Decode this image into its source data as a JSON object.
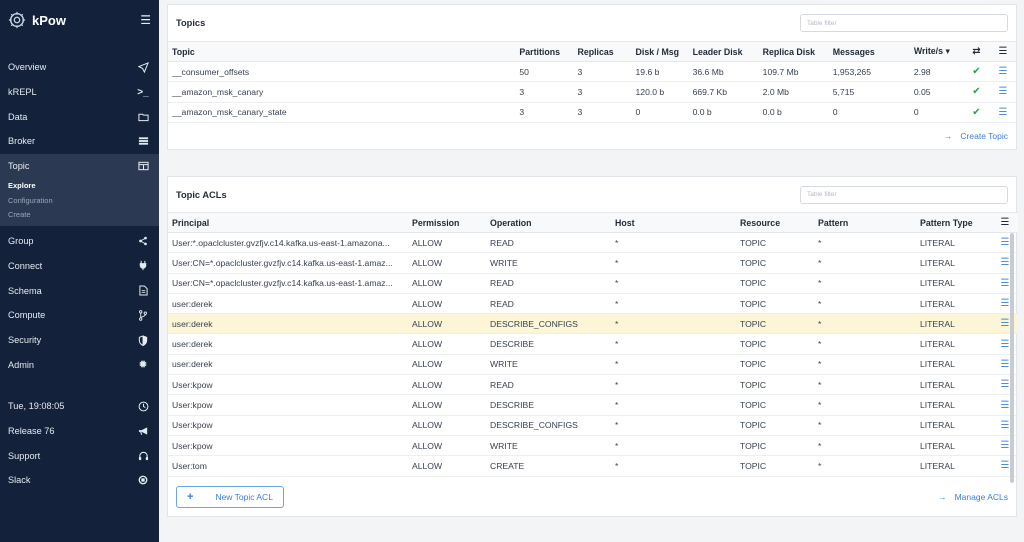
{
  "brand": {
    "name": "kPow"
  },
  "sidebar": {
    "items": [
      {
        "label": "Overview",
        "icon": "send-icon"
      },
      {
        "label": "kREPL",
        "icon": "terminal-icon"
      },
      {
        "label": "Data",
        "icon": "folder-icon"
      },
      {
        "label": "Broker",
        "icon": "server-icon"
      },
      {
        "label": "Topic",
        "icon": "table-icon"
      },
      {
        "label": "Group",
        "icon": "share-icon"
      },
      {
        "label": "Connect",
        "icon": "plug-icon"
      },
      {
        "label": "Schema",
        "icon": "file-icon"
      },
      {
        "label": "Compute",
        "icon": "branch-icon"
      },
      {
        "label": "Security",
        "icon": "shield-icon"
      },
      {
        "label": "Admin",
        "icon": "gear-icon"
      }
    ],
    "topic_sub": [
      "Explore",
      "Configuration",
      "Create"
    ],
    "footer": [
      {
        "label": "Tue, 19:08:05",
        "icon": "clock-icon"
      },
      {
        "label": "Release 76",
        "icon": "megaphone-icon"
      },
      {
        "label": "Support",
        "icon": "headset-icon"
      },
      {
        "label": "Slack",
        "icon": "slack-icon"
      }
    ]
  },
  "topics": {
    "title": "Topics",
    "filter_placeholder": "Table filter",
    "columns": [
      "Topic",
      "Partitions",
      "Replicas",
      "Disk / Msg",
      "Leader Disk",
      "Replica Disk",
      "Messages",
      "Write/s ▾"
    ],
    "rows": [
      [
        "__consumer_offsets",
        "50",
        "3",
        "19.6 b",
        "36.6 Mb",
        "109.7 Mb",
        "1,953,265",
        "2.98"
      ],
      [
        "__amazon_msk_canary",
        "3",
        "3",
        "120.0 b",
        "669.7 Kb",
        "2.0 Mb",
        "5,715",
        "0.05"
      ],
      [
        "__amazon_msk_canary_state",
        "3",
        "3",
        "0",
        "0.0 b",
        "0.0 b",
        "0",
        "0"
      ]
    ],
    "create_link": "Create Topic"
  },
  "acls": {
    "title": "Topic ACLs",
    "filter_placeholder": "Table filter",
    "columns": [
      "Principal",
      "Permission",
      "Operation",
      "Host",
      "Resource",
      "Pattern",
      "Pattern Type"
    ],
    "rows": [
      [
        "User:*.opaclcluster.gvzfjv.c14.kafka.us-east-1.amazona...",
        "ALLOW",
        "READ",
        "*",
        "TOPIC",
        "*",
        "LITERAL"
      ],
      [
        "User:CN=*.opaclcluster.gvzfjv.c14.kafka.us-east-1.amaz...",
        "ALLOW",
        "WRITE",
        "*",
        "TOPIC",
        "*",
        "LITERAL"
      ],
      [
        "User:CN=*.opaclcluster.gvzfjv.c14.kafka.us-east-1.amaz...",
        "ALLOW",
        "READ",
        "*",
        "TOPIC",
        "*",
        "LITERAL"
      ],
      [
        "user:derek",
        "ALLOW",
        "READ",
        "*",
        "TOPIC",
        "*",
        "LITERAL"
      ],
      [
        "user:derek",
        "ALLOW",
        "DESCRIBE_CONFIGS",
        "*",
        "TOPIC",
        "*",
        "LITERAL"
      ],
      [
        "user:derek",
        "ALLOW",
        "DESCRIBE",
        "*",
        "TOPIC",
        "*",
        "LITERAL"
      ],
      [
        "user:derek",
        "ALLOW",
        "WRITE",
        "*",
        "TOPIC",
        "*",
        "LITERAL"
      ],
      [
        "User:kpow",
        "ALLOW",
        "READ",
        "*",
        "TOPIC",
        "*",
        "LITERAL"
      ],
      [
        "User:kpow",
        "ALLOW",
        "DESCRIBE",
        "*",
        "TOPIC",
        "*",
        "LITERAL"
      ],
      [
        "User:kpow",
        "ALLOW",
        "DESCRIBE_CONFIGS",
        "*",
        "TOPIC",
        "*",
        "LITERAL"
      ],
      [
        "User:kpow",
        "ALLOW",
        "WRITE",
        "*",
        "TOPIC",
        "*",
        "LITERAL"
      ],
      [
        "User:tom",
        "ALLOW",
        "CREATE",
        "*",
        "TOPIC",
        "*",
        "LITERAL"
      ]
    ],
    "new_button": "New Topic ACL",
    "manage_link": "Manage ACLs"
  },
  "colors": {
    "sidebar_bg": "#14213a",
    "accent": "#3b7ddd",
    "ok": "#22a34b",
    "highlight": "#fdf6d6"
  }
}
